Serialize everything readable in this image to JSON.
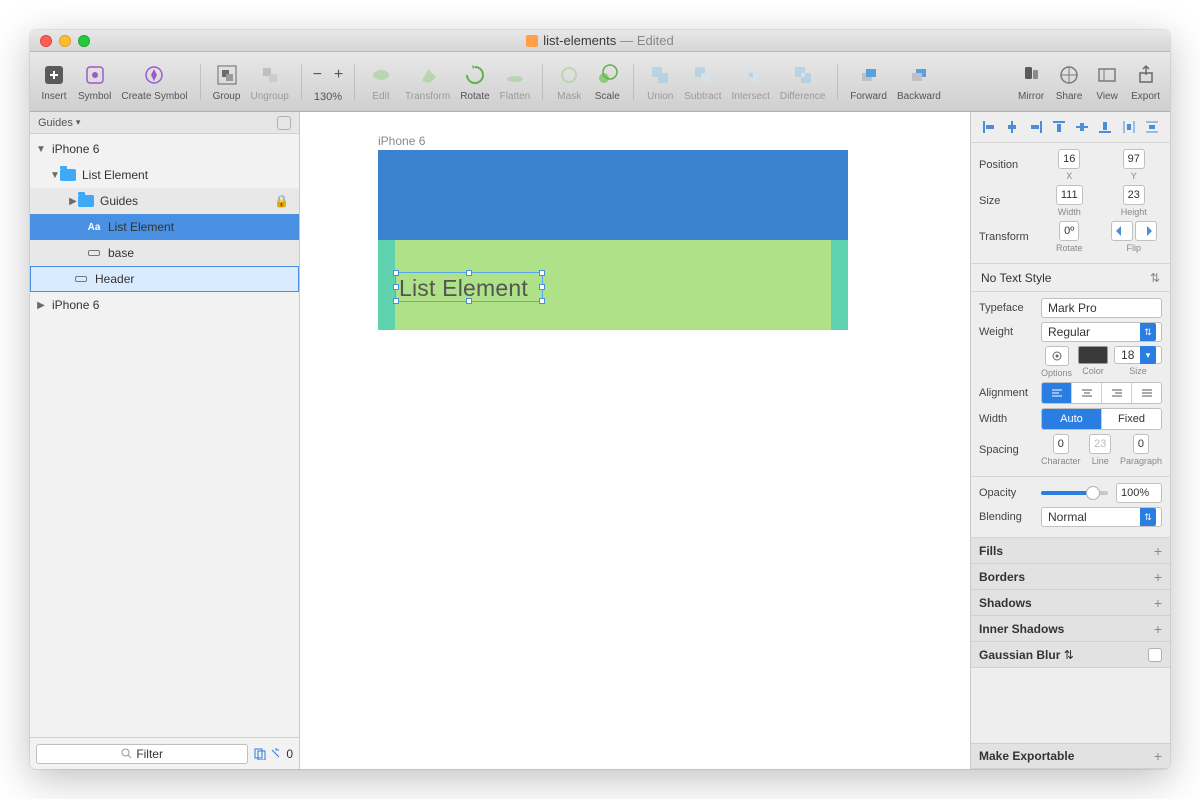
{
  "titlebar": {
    "title": "list-elements",
    "edited": "— Edited"
  },
  "toolbar": {
    "insert": "Insert",
    "symbol": "Symbol",
    "createSymbol": "Create Symbol",
    "group": "Group",
    "ungroup": "Ungroup",
    "zoom": "130%",
    "edit": "Edit",
    "transform": "Transform",
    "rotate": "Rotate",
    "flatten": "Flatten",
    "mask": "Mask",
    "scale": "Scale",
    "union": "Union",
    "subtract": "Subtract",
    "intersect": "Intersect",
    "difference": "Difference",
    "forward": "Forward",
    "backward": "Backward",
    "mirror": "Mirror",
    "share": "Share",
    "view": "View",
    "export": "Export"
  },
  "pages": {
    "header": "Guides",
    "count": "0"
  },
  "tree": {
    "iphone6a": "iPhone 6",
    "listElementGroup": "List Element",
    "guides": "Guides",
    "listElementText": "List Element",
    "base": "base",
    "header": "Header",
    "iphone6b": "iPhone 6"
  },
  "filterPlaceholder": "Filter",
  "canvas": {
    "artboardLabel": "iPhone 6",
    "elementText": "List Element"
  },
  "inspector": {
    "position": "Position",
    "x": "16",
    "xLbl": "X",
    "y": "97",
    "yLbl": "Y",
    "size": "Size",
    "w": "111",
    "wLbl": "Width",
    "h": "23",
    "hLbl": "Height",
    "transform": "Transform",
    "rot": "0º",
    "rotLbl": "Rotate",
    "flipLbl": "Flip",
    "noTextStyle": "No Text Style",
    "typeface": "Typeface",
    "typefaceVal": "Mark Pro",
    "weight": "Weight",
    "weightVal": "Regular",
    "optionsLbl": "Options",
    "colorLbl": "Color",
    "sizeLbl": "Size",
    "sizeVal": "18",
    "alignment": "Alignment",
    "width": "Width",
    "auto": "Auto",
    "fixed": "Fixed",
    "spacing": "Spacing",
    "char": "0",
    "charLbl": "Character",
    "line": "23",
    "lineLbl": "Line",
    "para": "0",
    "paraLbl": "Paragraph",
    "opacity": "Opacity",
    "opacityVal": "100%",
    "blending": "Blending",
    "blendingVal": "Normal",
    "fills": "Fills",
    "borders": "Borders",
    "shadows": "Shadows",
    "innerShadows": "Inner Shadows",
    "gaussianBlur": "Gaussian Blur",
    "makeExportable": "Make Exportable"
  }
}
